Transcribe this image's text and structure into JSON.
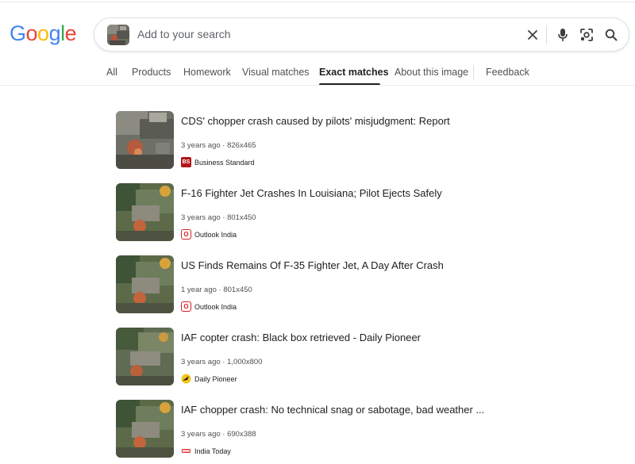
{
  "logo": {
    "letters": [
      "G",
      "o",
      "o",
      "g",
      "l",
      "e"
    ],
    "colors": [
      "#4285F4",
      "#EA4335",
      "#FBBC05",
      "#4285F4",
      "#34A853",
      "#EA4335"
    ]
  },
  "search": {
    "placeholder": "Add to your search",
    "icons": [
      "image-thumb-icon",
      "close-icon",
      "microphone-icon",
      "lens-icon",
      "search-icon"
    ]
  },
  "tabs": [
    {
      "label": "All",
      "active": false
    },
    {
      "label": "Products",
      "active": false
    },
    {
      "label": "Homework",
      "active": false
    },
    {
      "label": "Visual matches",
      "active": false
    },
    {
      "label": "Exact matches",
      "active": true
    },
    {
      "label": "About this image",
      "active": false
    },
    {
      "label": "Feedback",
      "active": false
    }
  ],
  "results": [
    {
      "title": "CDS' chopper crash caused by pilots' misjudgment: Report",
      "age": "3 years ago",
      "size": "826x465",
      "source": "Business Standard",
      "favicon": "business-standard-icon"
    },
    {
      "title": "F-16 Fighter Jet Crashes In Louisiana; Pilot Ejects Safely",
      "age": "3 years ago",
      "size": "801x450",
      "source": "Outlook India",
      "favicon": "outlook-india-icon"
    },
    {
      "title": "US Finds Remains Of F-35 Fighter Jet, A Day After Crash",
      "age": "1 year ago",
      "size": "801x450",
      "source": "Outlook India",
      "favicon": "outlook-india-icon"
    },
    {
      "title": "IAF copter crash: Black box retrieved - Daily Pioneer",
      "age": "3 years ago",
      "size": "1,000x800",
      "source": "Daily Pioneer",
      "favicon": "daily-pioneer-icon"
    },
    {
      "title": "IAF chopper crash: No technical snag or sabotage, bad weather ...",
      "age": "3 years ago",
      "size": "690x388",
      "source": "India Today",
      "favicon": "india-today-icon"
    }
  ],
  "colors": {
    "accent": "#202124",
    "muted": "#4d5156",
    "bs_red": "#b3151b",
    "outlook_red": "#d32027",
    "pioneer_yellow": "#f5c518"
  },
  "meta_separator": "·"
}
